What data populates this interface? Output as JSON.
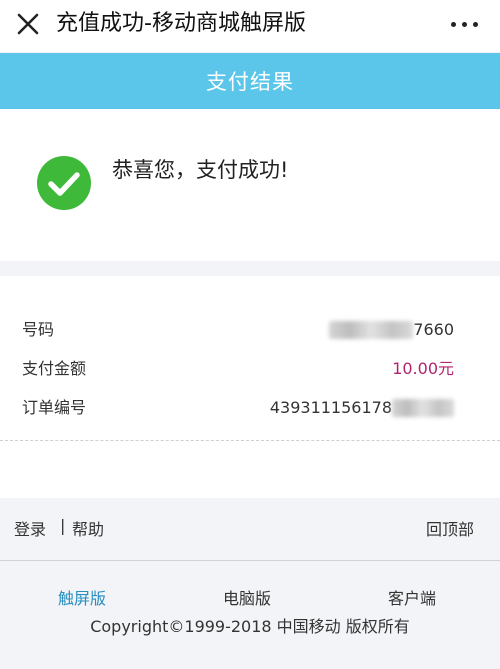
{
  "header": {
    "title": "充值成功-移动商城触屏版"
  },
  "section_bar": {
    "title": "支付结果"
  },
  "success": {
    "message": "恭喜您，支付成功!"
  },
  "details": {
    "phone": {
      "label": "号码",
      "value_visible": "7660"
    },
    "amount": {
      "label": "支付金额",
      "value": "10.00元"
    },
    "order": {
      "label": "订单编号",
      "value_visible": "439311156178"
    }
  },
  "footer_links": {
    "login": "登录",
    "separator": "|",
    "help": "帮助",
    "back_to_top": "回顶部"
  },
  "versions": {
    "touch": "触屏版",
    "pc": "电脑版",
    "client": "客户端",
    "copyright": "Copyright©1999-2018 中国移动 版权所有"
  },
  "colors": {
    "accent_bar": "#5bc6ea",
    "success_green": "#3fb93a",
    "amount_color": "#b0246e",
    "active_version": "#2a8fc0"
  },
  "icons": {
    "close": "close-icon",
    "more": "more-icon",
    "success": "check-circle-icon"
  }
}
